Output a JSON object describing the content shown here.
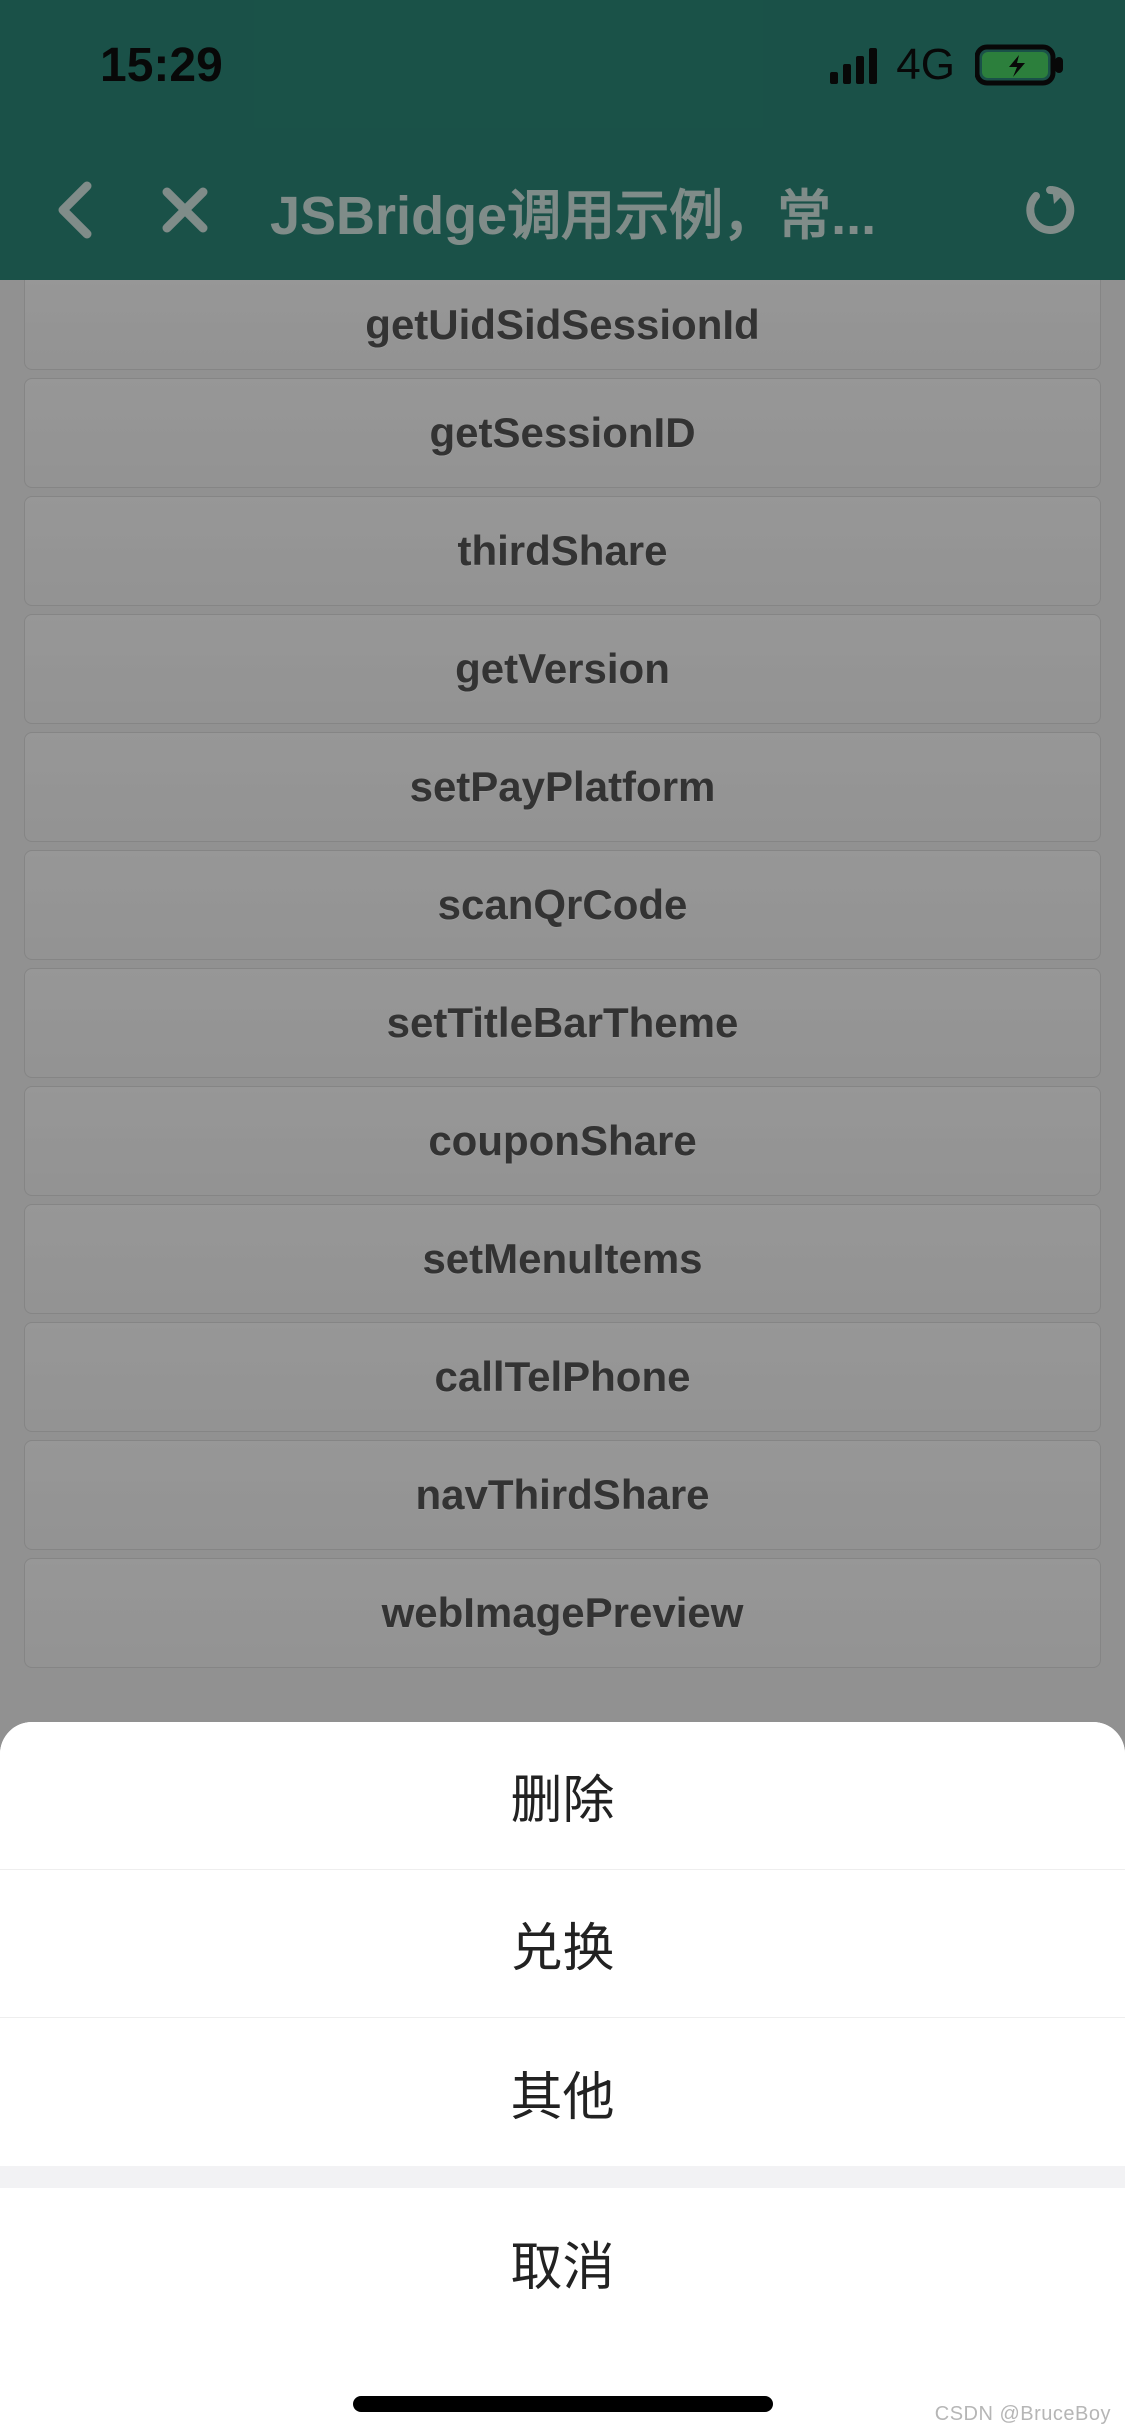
{
  "status": {
    "time": "15:29",
    "network": "4G"
  },
  "nav": {
    "title": "JSBridge调用示例，常..."
  },
  "list": {
    "items": [
      {
        "label": "getUidSidSessionId"
      },
      {
        "label": "getSessionID"
      },
      {
        "label": "thirdShare"
      },
      {
        "label": "getVersion"
      },
      {
        "label": "setPayPlatform"
      },
      {
        "label": "scanQrCode"
      },
      {
        "label": "setTitleBarTheme"
      },
      {
        "label": "couponShare"
      },
      {
        "label": "setMenuItems"
      },
      {
        "label": "callTelPhone"
      },
      {
        "label": "navThirdShare"
      },
      {
        "label": "webImagePreview"
      }
    ]
  },
  "sheet": {
    "options": [
      {
        "label": "删除"
      },
      {
        "label": "兑换"
      },
      {
        "label": "其他"
      }
    ],
    "cancel": "取消"
  },
  "watermark": "CSDN @BruceBoy"
}
